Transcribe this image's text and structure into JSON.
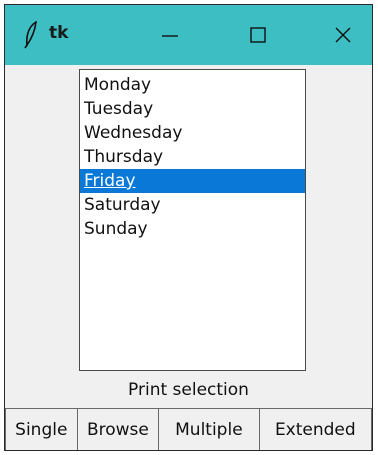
{
  "window": {
    "title": "tk",
    "icons": [
      "feather-icon",
      "minimize-icon",
      "maximize-icon",
      "close-icon"
    ]
  },
  "listbox": {
    "items": [
      "Monday",
      "Tuesday",
      "Wednesday",
      "Thursday",
      "Friday",
      "Saturday",
      "Sunday"
    ],
    "selected_item": "Friday",
    "selection_color": "#0a78d7"
  },
  "print_button": {
    "label": "Print selection"
  },
  "mode_buttons": [
    {
      "label": "Single"
    },
    {
      "label": "Browse"
    },
    {
      "label": "Multiple"
    },
    {
      "label": "Extended"
    }
  ],
  "colors": {
    "titlebar": "#3cbec2",
    "window_bg": "#f0f0f0"
  }
}
